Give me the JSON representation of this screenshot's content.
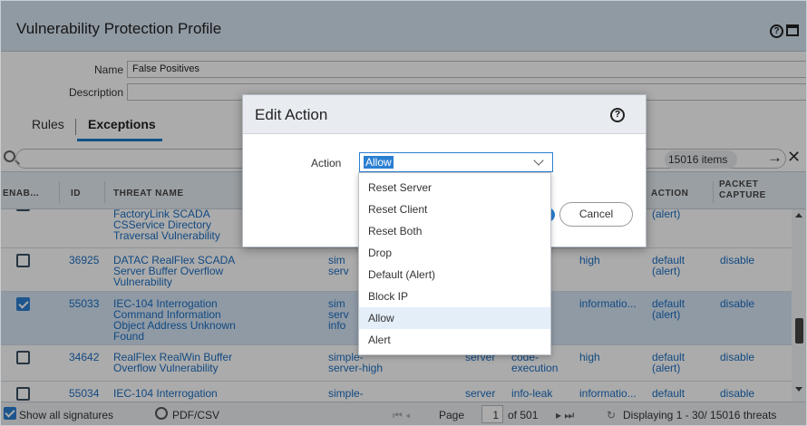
{
  "window": {
    "title": "Vulnerability Protection Profile"
  },
  "form": {
    "name_label": "Name",
    "name_value": "False Positives",
    "description_label": "Description",
    "description_value": ""
  },
  "tabs": [
    {
      "label": "Rules"
    },
    {
      "label": "Exceptions"
    }
  ],
  "search": {
    "items_count": "15016 items"
  },
  "columns": {
    "enable": "ENAB...",
    "id": "ID",
    "threat_name": "THREAT NAME",
    "action": "ACTION",
    "packet_capture_1": "PACKET",
    "packet_capture_2": "CAPTURE"
  },
  "rows": [
    {
      "checked": false,
      "id": "",
      "name": [
        "FactoryLink SCADA",
        "CSService Directory",
        "Traversal Vulnerability"
      ],
      "host": [],
      "type": "",
      "category": "",
      "severity": "",
      "action": [
        "(alert)"
      ],
      "capture": ""
    },
    {
      "checked": false,
      "id": "36925",
      "name": [
        "DATAC RealFlex SCADA",
        "Server Buffer Overflow",
        "Vulnerability"
      ],
      "host": [
        "sim",
        "serv"
      ],
      "type": "",
      "category": "",
      "severity": "high",
      "action": [
        "default",
        "(alert)"
      ],
      "capture": "disable"
    },
    {
      "checked": true,
      "id": "55033",
      "name": [
        "IEC-104 Interrogation",
        "Command Information",
        "Object Address Unknown",
        "Found"
      ],
      "host": [
        "sim",
        "serv",
        "info"
      ],
      "type": "",
      "category": "",
      "severity": "informatio...",
      "action": [
        "default",
        "(alert)"
      ],
      "capture": "disable"
    },
    {
      "checked": false,
      "id": "34642",
      "name": [
        "RealFlex RealWin Buffer",
        "Overflow Vulnerability"
      ],
      "host": [
        "simple-",
        "server-high"
      ],
      "type": "server",
      "category": [
        "code-",
        "execution"
      ],
      "severity": "high",
      "action": [
        "default",
        "(alert)"
      ],
      "capture": "disable"
    },
    {
      "checked": false,
      "id": "55034",
      "name": [
        "IEC-104 Interrogation"
      ],
      "host": [
        "simple-"
      ],
      "type": "server",
      "category": [
        "info-leak"
      ],
      "severity": "informatio...",
      "action": [
        "default"
      ],
      "capture": "disable"
    }
  ],
  "footer": {
    "show_all": "Show all signatures",
    "pdf_csv": "PDF/CSV",
    "page_label": "Page",
    "page_value": "1",
    "of_pages": "of 501",
    "displaying": "Displaying 1 - 30/ 15016 threats"
  },
  "modal": {
    "title": "Edit Action",
    "action_label": "Action",
    "action_value": "Allow",
    "cancel_label": "Cancel",
    "options": [
      "Reset Server",
      "Reset Client",
      "Reset Both",
      "Drop",
      "Default (Alert)",
      "Block IP",
      "Allow",
      "Alert"
    ],
    "highlighted_option": "Allow"
  }
}
